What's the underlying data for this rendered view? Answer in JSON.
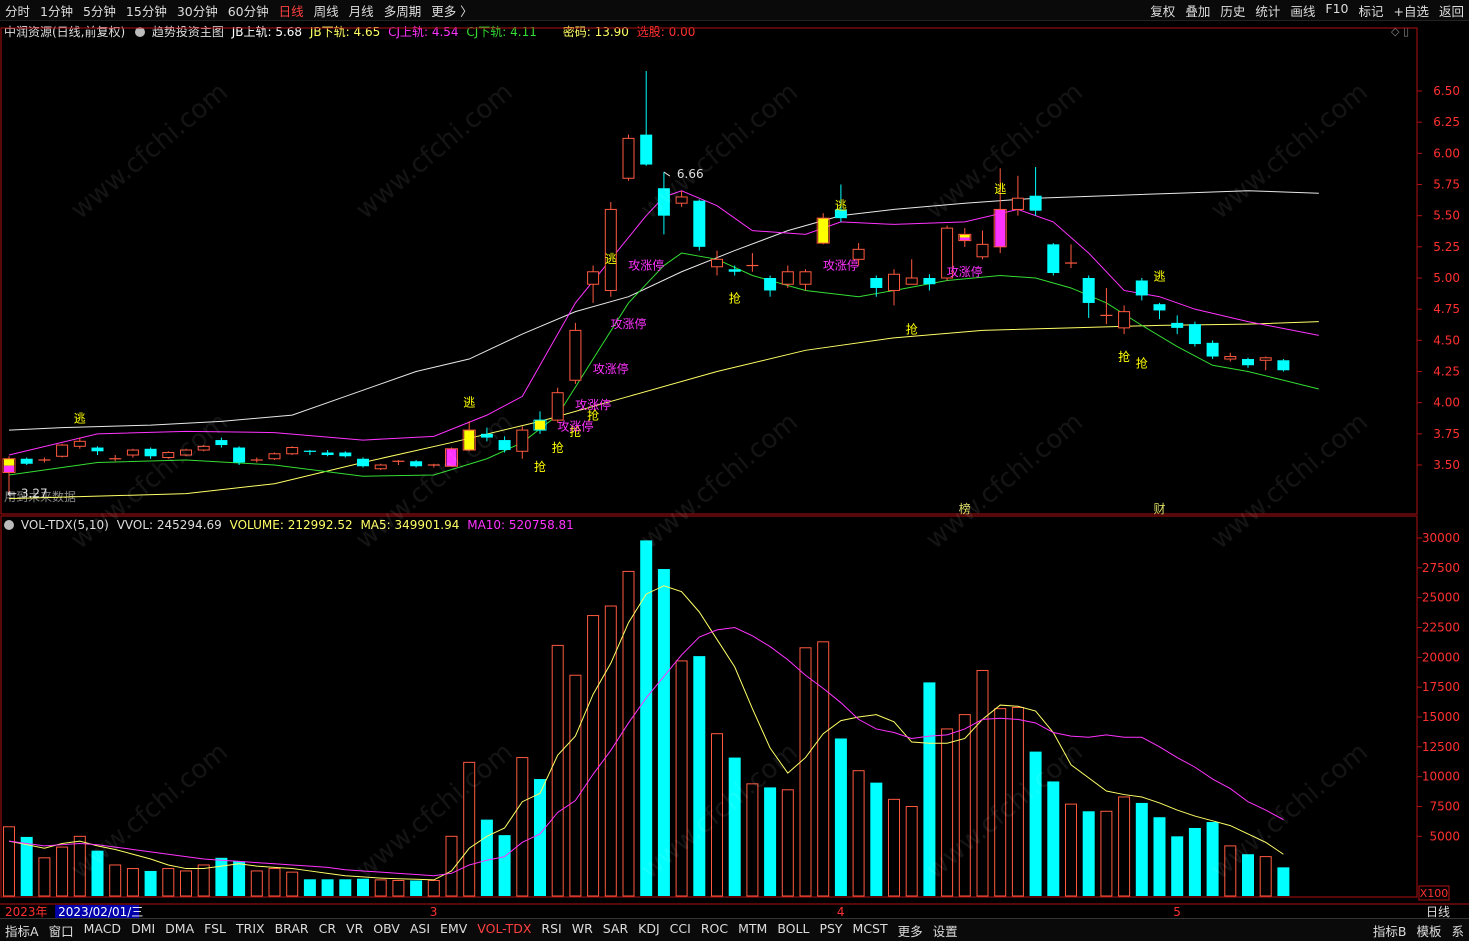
{
  "top_menu": {
    "periods": [
      "分时",
      "1分钟",
      "5分钟",
      "15分钟",
      "30分钟",
      "60分钟",
      "日线",
      "周线",
      "月线",
      "多周期",
      "更多 〉"
    ],
    "active_period": "日线",
    "tools": [
      "复权",
      "叠加",
      "历史",
      "统计",
      "画线",
      "F10",
      "标记",
      "+自选",
      "返回"
    ]
  },
  "info_bar": {
    "stock": "中润资源(日线,前复权)",
    "indicator": "趋势投资主图",
    "jb_up": "JB上轨: 5.68",
    "jb_down": "JB下轨: 4.65",
    "cj_up": "CJ上轨: 4.54",
    "cj_down": "CJ下轨: 4.11",
    "mima": "密码: 13.90",
    "xuangu": "选股: 0.00",
    "future_note": "用到未来数据"
  },
  "vol_bar": {
    "name": "VOL-TDX(5,10)",
    "vvol": "VVOL: 245294.69",
    "volume": "VOLUME: 212992.52",
    "ma5": "MA5: 349901.94",
    "ma10": "MA10: 520758.81",
    "unit": "X100"
  },
  "bottom_tabs": {
    "left": "指标A",
    "items": [
      "窗口",
      "MACD",
      "DMI",
      "DMA",
      "FSL",
      "TRIX",
      "BRAR",
      "CR",
      "VR",
      "OBV",
      "ASI",
      "EMV",
      "VOL-TDX",
      "RSI",
      "WR",
      "SAR",
      "KDJ",
      "CCI",
      "ROC",
      "MTM",
      "BOLL",
      "PSY",
      "MCST",
      "更多",
      "设置"
    ],
    "active": "VOL-TDX",
    "right": [
      "指标B",
      "模板",
      "系"
    ]
  },
  "colors": {
    "up": "#ff5a40",
    "down": "#00ffff",
    "white_line": "#e8e8e8",
    "yellow_line": "#ffff66",
    "magenta_line": "#ff33ff",
    "green_line": "#33dd33",
    "signal_yellow": "#ffff00",
    "signal_magenta": "#ff33ff"
  },
  "chart_data": {
    "type": "candlestick",
    "price_axis": {
      "ticks": [
        3.5,
        3.75,
        4.0,
        4.25,
        4.5,
        4.75,
        5.0,
        5.25,
        5.5,
        5.75,
        6.0,
        6.25,
        6.5
      ]
    },
    "volume_axis": {
      "ticks": [
        5000,
        7500,
        10000,
        12500,
        15000,
        17500,
        20000,
        22500,
        25000,
        27500,
        30000
      ]
    },
    "x_labels": [
      {
        "i": 0,
        "text": "2023年",
        "color": "#ff3030"
      },
      {
        "i": 3,
        "text": "2023/02/01/三",
        "color": "#ffffff",
        "bg": "#0000aa"
      },
      {
        "i": 24,
        "text": "3",
        "color": "#ff3030"
      },
      {
        "i": 47,
        "text": "4",
        "color": "#ff3030"
      },
      {
        "i": 66,
        "text": "5",
        "color": "#ff3030"
      }
    ],
    "period_label": "日线",
    "hi_label": {
      "i": 37,
      "text": "6.66"
    },
    "lo_label": {
      "i": 0,
      "text": "3.27"
    },
    "bottom_marks": [
      {
        "i": 54,
        "text": "榜"
      },
      {
        "i": 65,
        "text": "财"
      }
    ],
    "candles": [
      [
        3.44,
        3.55,
        3.57,
        3.27
      ],
      [
        3.55,
        3.51,
        3.56,
        3.5
      ],
      [
        3.53,
        3.54,
        3.56,
        3.52
      ],
      [
        3.57,
        3.66,
        3.67,
        3.56
      ],
      [
        3.65,
        3.69,
        3.72,
        3.63
      ],
      [
        3.64,
        3.61,
        3.65,
        3.58
      ],
      [
        3.55,
        3.55,
        3.58,
        3.53
      ],
      [
        3.58,
        3.62,
        3.63,
        3.56
      ],
      [
        3.63,
        3.57,
        3.64,
        3.55
      ],
      [
        3.56,
        3.6,
        3.61,
        3.55
      ],
      [
        3.58,
        3.62,
        3.63,
        3.57
      ],
      [
        3.62,
        3.65,
        3.66,
        3.61
      ],
      [
        3.7,
        3.66,
        3.72,
        3.64
      ],
      [
        3.64,
        3.52,
        3.65,
        3.5
      ],
      [
        3.54,
        3.54,
        3.56,
        3.52
      ],
      [
        3.55,
        3.59,
        3.6,
        3.54
      ],
      [
        3.59,
        3.64,
        3.65,
        3.58
      ],
      [
        3.61,
        3.6,
        3.62,
        3.58
      ],
      [
        3.6,
        3.58,
        3.62,
        3.57
      ],
      [
        3.6,
        3.57,
        3.61,
        3.56
      ],
      [
        3.55,
        3.49,
        3.56,
        3.48
      ],
      [
        3.47,
        3.5,
        3.51,
        3.46
      ],
      [
        3.52,
        3.53,
        3.54,
        3.5
      ],
      [
        3.53,
        3.49,
        3.54,
        3.48
      ],
      [
        3.49,
        3.5,
        3.51,
        3.48
      ],
      [
        3.49,
        3.63,
        3.64,
        3.49
      ],
      [
        3.62,
        3.78,
        3.85,
        3.61
      ],
      [
        3.75,
        3.72,
        3.8,
        3.69
      ],
      [
        3.7,
        3.62,
        3.73,
        3.6
      ],
      [
        3.61,
        3.78,
        3.81,
        3.55
      ],
      [
        3.86,
        3.78,
        3.93,
        3.75
      ],
      [
        3.86,
        4.08,
        4.12,
        3.84
      ],
      [
        4.18,
        4.58,
        4.64,
        4.15
      ],
      [
        4.95,
        5.05,
        5.1,
        4.8
      ],
      [
        4.9,
        5.55,
        5.61,
        4.85
      ],
      [
        5.8,
        6.12,
        6.15,
        5.78
      ],
      [
        6.15,
        5.91,
        6.66,
        5.9
      ],
      [
        5.72,
        5.5,
        5.85,
        5.35
      ],
      [
        5.6,
        5.65,
        5.7,
        5.57
      ],
      [
        5.62,
        5.25,
        5.63,
        5.22
      ],
      [
        5.09,
        5.15,
        5.22,
        5.02
      ],
      [
        5.07,
        5.05,
        5.1,
        5.02
      ],
      [
        5.1,
        5.1,
        5.2,
        5.05
      ],
      [
        5.0,
        4.9,
        5.02,
        4.85
      ],
      [
        4.95,
        5.05,
        5.1,
        4.92
      ],
      [
        4.95,
        5.05,
        5.07,
        4.9
      ],
      [
        5.28,
        5.48,
        5.52,
        5.27
      ],
      [
        5.55,
        5.48,
        5.75,
        5.45
      ],
      [
        5.15,
        5.23,
        5.28,
        5.1
      ],
      [
        5.0,
        4.92,
        5.02,
        4.85
      ],
      [
        4.9,
        5.03,
        5.07,
        4.78
      ],
      [
        4.95,
        5.0,
        5.15,
        4.95
      ],
      [
        5.0,
        4.95,
        5.03,
        4.9
      ],
      [
        5.0,
        5.4,
        5.42,
        4.98
      ],
      [
        5.3,
        5.35,
        5.4,
        5.25
      ],
      [
        5.17,
        5.27,
        5.38,
        5.15
      ],
      [
        5.25,
        5.55,
        5.88,
        5.2
      ],
      [
        5.55,
        5.64,
        5.82,
        5.5
      ],
      [
        5.66,
        5.54,
        5.89,
        5.5
      ],
      [
        5.27,
        5.04,
        5.28,
        5.02
      ],
      [
        5.12,
        5.12,
        5.27,
        5.08
      ],
      [
        5.0,
        4.8,
        5.02,
        4.68
      ],
      [
        4.7,
        4.7,
        4.92,
        4.63
      ],
      [
        4.6,
        4.73,
        4.78,
        4.55
      ],
      [
        4.98,
        4.86,
        5.0,
        4.82
      ],
      [
        4.79,
        4.74,
        4.8,
        4.67
      ],
      [
        4.64,
        4.6,
        4.7,
        4.55
      ],
      [
        4.63,
        4.47,
        4.65,
        4.45
      ],
      [
        4.48,
        4.37,
        4.5,
        4.35
      ],
      [
        4.35,
        4.37,
        4.4,
        4.33
      ],
      [
        4.35,
        4.3,
        4.36,
        4.28
      ],
      [
        4.34,
        4.36,
        4.37,
        4.26
      ],
      [
        4.34,
        4.26,
        4.35,
        4.25
      ]
    ],
    "volume": [
      5800,
      4950,
      3200,
      4100,
      5000,
      3800,
      2600,
      2300,
      2100,
      2300,
      2100,
      2600,
      3200,
      2900,
      2100,
      2300,
      2000,
      1400,
      1400,
      1400,
      1450,
      1350,
      1300,
      1300,
      1300,
      5000,
      11200,
      6400,
      5100,
      11600,
      9800,
      21000,
      18500,
      23500,
      24300,
      27200,
      29800,
      27400,
      19700,
      20100,
      13600,
      11600,
      9400,
      9100,
      8900,
      20800,
      21300,
      13200,
      10500,
      9500,
      8100,
      7500,
      17900,
      14000,
      15200,
      18900,
      15700,
      15800,
      12100,
      9600,
      7700,
      7100,
      7100,
      8300,
      7800,
      6600,
      5000,
      5700,
      6200,
      4200,
      3500,
      3300,
      2400
    ],
    "vol_ma5": [
      4600,
      4300,
      4000,
      4400,
      4600,
      4200,
      3900,
      3500,
      3100,
      2600,
      2300,
      2300,
      2500,
      2700,
      2500,
      2400,
      2300,
      2100,
      1900,
      1700,
      1600,
      1500,
      1450,
      1400,
      1350,
      2100,
      4000,
      5000,
      5700,
      7900,
      8600,
      11800,
      13400,
      16900,
      19500,
      22900,
      25300,
      26000,
      25500,
      23800,
      21500,
      19200,
      15700,
      12400,
      10300,
      11600,
      13600,
      14700,
      15000,
      15200,
      14600,
      12900,
      12800,
      12800,
      13200,
      14800,
      16000,
      15900,
      15500,
      13700,
      11000,
      9900,
      8800,
      8500,
      8300,
      7800,
      7200,
      6700,
      6300,
      5900,
      5200,
      4500,
      3500
    ],
    "vol_ma10": [
      4600,
      4400,
      4200,
      4300,
      4400,
      4300,
      4100,
      3900,
      3700,
      3500,
      3300,
      3100,
      3000,
      2900,
      2800,
      2700,
      2600,
      2500,
      2400,
      2200,
      2100,
      2000,
      1900,
      1800,
      1700,
      1900,
      2600,
      3000,
      3300,
      4500,
      5200,
      7000,
      8000,
      10200,
      12200,
      14500,
      16600,
      18400,
      20200,
      21700,
      22300,
      22500,
      21800,
      20900,
      19800,
      18500,
      17400,
      16200,
      14800,
      14000,
      13700,
      13200,
      13400,
      13500,
      14000,
      14800,
      14900,
      14800,
      14500,
      13700,
      13400,
      13300,
      13500,
      13300,
      13300,
      12500,
      11600,
      10800,
      9800,
      9000,
      7900,
      7200,
      6400
    ],
    "white_line": [
      [
        0,
        3.78
      ],
      [
        3,
        3.8
      ],
      [
        8,
        3.82
      ],
      [
        12,
        3.85
      ],
      [
        16,
        3.9
      ],
      [
        19,
        4.05
      ],
      [
        23,
        4.25
      ],
      [
        26,
        4.35
      ],
      [
        29,
        4.55
      ],
      [
        32,
        4.73
      ],
      [
        35,
        4.85
      ],
      [
        38,
        5.05
      ],
      [
        41,
        5.22
      ],
      [
        44,
        5.38
      ],
      [
        47,
        5.5
      ],
      [
        50,
        5.55
      ],
      [
        54,
        5.6
      ],
      [
        58,
        5.64
      ],
      [
        62,
        5.66
      ],
      [
        66,
        5.68
      ],
      [
        70,
        5.7
      ],
      [
        74,
        5.68
      ]
    ],
    "yellow_line": [
      [
        0,
        3.23
      ],
      [
        5,
        3.25
      ],
      [
        10,
        3.27
      ],
      [
        15,
        3.35
      ],
      [
        20,
        3.52
      ],
      [
        25,
        3.68
      ],
      [
        30,
        3.85
      ],
      [
        35,
        4.05
      ],
      [
        40,
        4.25
      ],
      [
        45,
        4.42
      ],
      [
        50,
        4.52
      ],
      [
        55,
        4.58
      ],
      [
        60,
        4.6
      ],
      [
        65,
        4.62
      ],
      [
        70,
        4.63
      ],
      [
        74,
        4.65
      ]
    ],
    "magenta_line": [
      [
        0,
        3.58
      ],
      [
        5,
        3.75
      ],
      [
        10,
        3.77
      ],
      [
        15,
        3.76
      ],
      [
        20,
        3.7
      ],
      [
        24,
        3.73
      ],
      [
        27,
        3.9
      ],
      [
        29,
        4.05
      ],
      [
        32,
        4.8
      ],
      [
        34,
        5.15
      ],
      [
        36,
        5.5
      ],
      [
        37,
        5.65
      ],
      [
        38,
        5.7
      ],
      [
        40,
        5.58
      ],
      [
        42,
        5.38
      ],
      [
        45,
        5.35
      ],
      [
        47,
        5.45
      ],
      [
        50,
        5.43
      ],
      [
        54,
        5.45
      ],
      [
        57,
        5.55
      ],
      [
        59,
        5.45
      ],
      [
        61,
        5.2
      ],
      [
        63,
        4.9
      ],
      [
        65,
        4.85
      ],
      [
        67,
        4.75
      ],
      [
        70,
        4.65
      ],
      [
        74,
        4.54
      ]
    ],
    "green_line": [
      [
        0,
        3.42
      ],
      [
        5,
        3.52
      ],
      [
        10,
        3.54
      ],
      [
        15,
        3.5
      ],
      [
        20,
        3.41
      ],
      [
        24,
        3.42
      ],
      [
        27,
        3.55
      ],
      [
        29,
        3.68
      ],
      [
        31,
        3.9
      ],
      [
        33,
        4.35
      ],
      [
        35,
        4.8
      ],
      [
        37,
        5.1
      ],
      [
        38,
        5.2
      ],
      [
        40,
        5.15
      ],
      [
        42,
        5.02
      ],
      [
        45,
        4.9
      ],
      [
        48,
        4.85
      ],
      [
        50,
        4.9
      ],
      [
        53,
        4.98
      ],
      [
        56,
        5.02
      ],
      [
        58,
        5.0
      ],
      [
        60,
        4.92
      ],
      [
        62,
        4.8
      ],
      [
        64,
        4.62
      ],
      [
        66,
        4.45
      ],
      [
        68,
        4.3
      ],
      [
        70,
        4.25
      ],
      [
        74,
        4.11
      ]
    ],
    "signals": [
      {
        "i": 4,
        "text": "逃",
        "color": "#ffff00",
        "price": 3.84,
        "pos": "above"
      },
      {
        "i": 26,
        "text": "逃",
        "color": "#ffff00",
        "price": 3.97,
        "pos": "above"
      },
      {
        "i": 30,
        "text": "抢",
        "color": "#ffff00",
        "price": 3.55,
        "pos": "below"
      },
      {
        "i": 31,
        "text": "抢",
        "color": "#ffff00",
        "price": 3.7,
        "pos": "below"
      },
      {
        "i": 32,
        "text": "抢",
        "color": "#ffff00",
        "price": 3.83,
        "pos": "below"
      },
      {
        "i": 32,
        "text": "攻涨停",
        "color": "#ff33ff",
        "price": 3.81,
        "pos": "label"
      },
      {
        "i": 33,
        "text": "抢",
        "color": "#ffff00",
        "price": 3.96,
        "pos": "below"
      },
      {
        "i": 33,
        "text": "攻涨停",
        "color": "#ff33ff",
        "price": 3.98,
        "pos": "label"
      },
      {
        "i": 34,
        "text": "攻涨停",
        "color": "#ff33ff",
        "price": 4.27,
        "pos": "label"
      },
      {
        "i": 34,
        "text": "逃",
        "color": "#ffff00",
        "price": 5.12,
        "pos": "above"
      },
      {
        "i": 35,
        "text": "攻涨停",
        "color": "#ff33ff",
        "price": 4.63,
        "pos": "label"
      },
      {
        "i": 36,
        "text": "攻涨停",
        "color": "#ff33ff",
        "price": 5.1,
        "pos": "label"
      },
      {
        "i": 41,
        "text": "抢",
        "color": "#ffff00",
        "price": 4.9,
        "pos": "below"
      },
      {
        "i": 47,
        "text": "逃",
        "color": "#ffff00",
        "price": 5.55,
        "pos": "above"
      },
      {
        "i": 47,
        "text": "攻涨停",
        "color": "#ff33ff",
        "price": 5.1,
        "pos": "label"
      },
      {
        "i": 51,
        "text": "抢",
        "color": "#ffff00",
        "price": 4.65,
        "pos": "below"
      },
      {
        "i": 54,
        "text": "攻涨停",
        "color": "#ff33ff",
        "price": 5.05,
        "pos": "label"
      },
      {
        "i": 56,
        "text": "逃",
        "color": "#ffff00",
        "price": 5.68,
        "pos": "above"
      },
      {
        "i": 63,
        "text": "抢",
        "color": "#ffff00",
        "price": 4.43,
        "pos": "below"
      },
      {
        "i": 64,
        "text": "抢",
        "color": "#ffff00",
        "price": 4.38,
        "pos": "below"
      },
      {
        "i": 65,
        "text": "逃",
        "color": "#ffff00",
        "price": 4.98,
        "pos": "above"
      }
    ],
    "yellow_bars": [
      0,
      26,
      30,
      46,
      54
    ],
    "magenta_bars": [
      0,
      25,
      54,
      56
    ]
  }
}
